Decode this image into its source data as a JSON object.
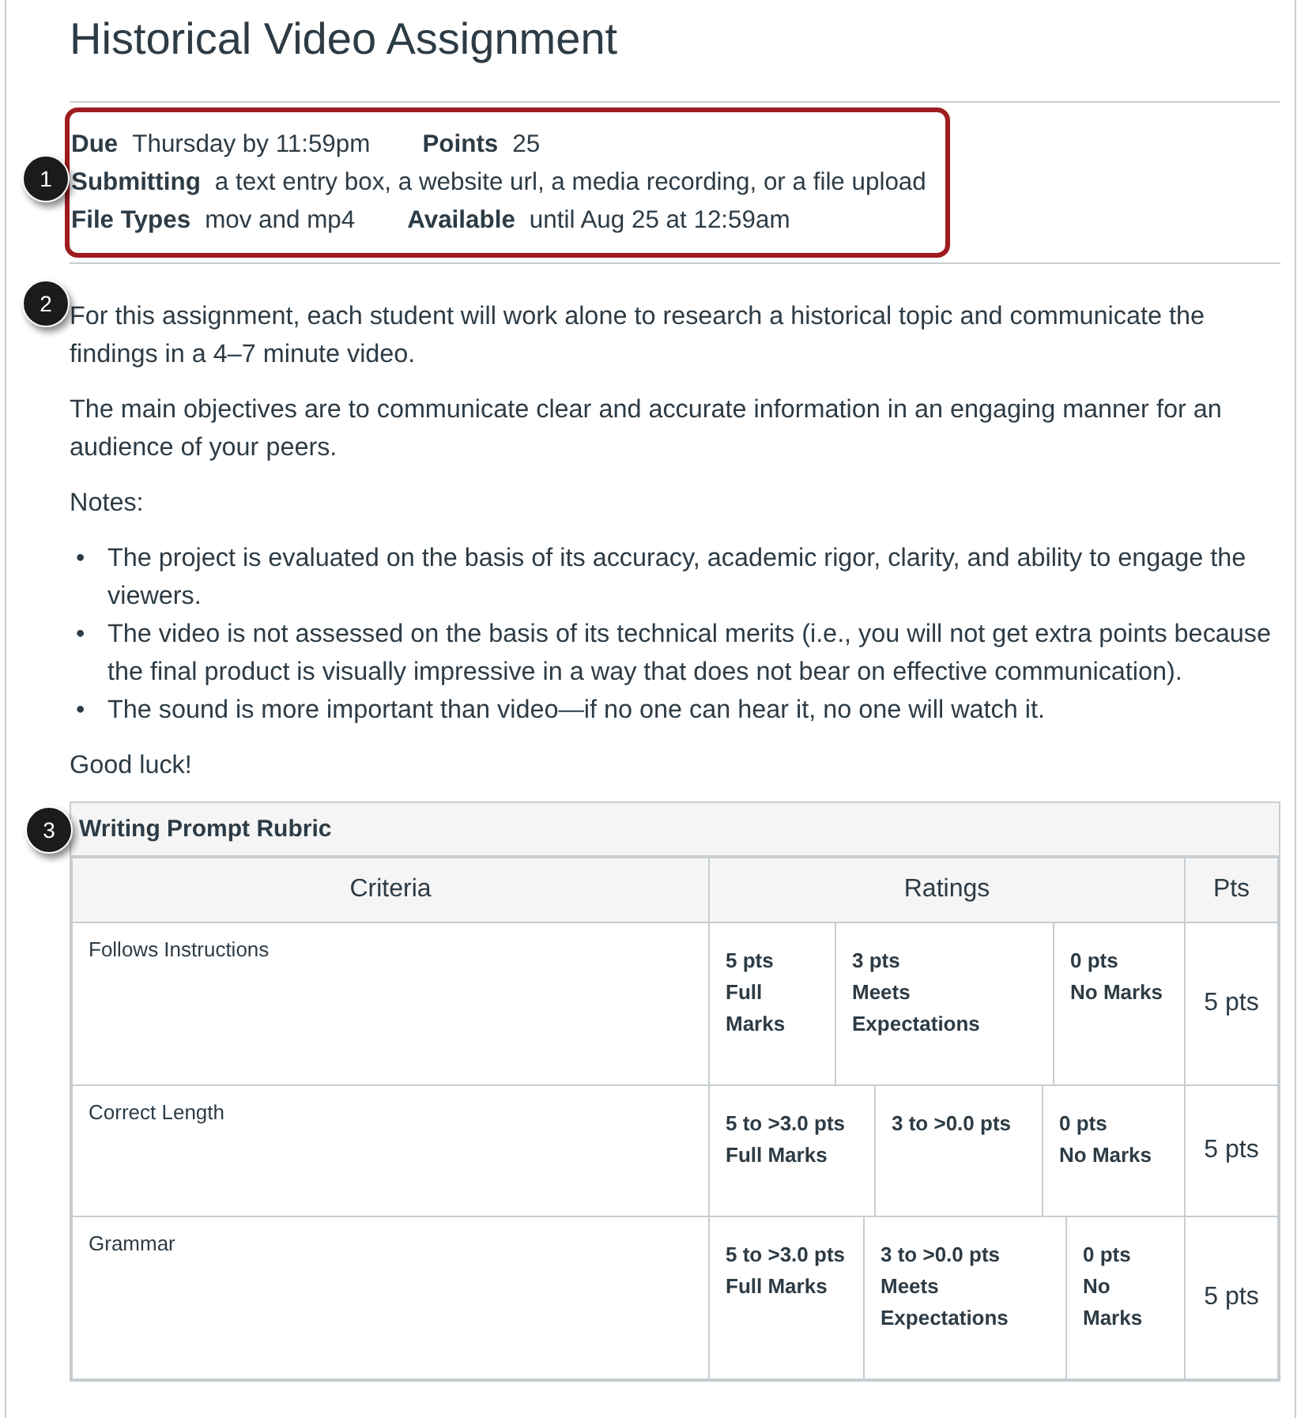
{
  "title": "Historical Video Assignment",
  "details": {
    "callout": "1",
    "rows": [
      [
        {
          "label": "Due",
          "value": "Thursday by 11:59pm"
        },
        {
          "label": "Points",
          "value": "25"
        }
      ],
      [
        {
          "label": "Submitting",
          "value": "a text entry box, a website url, a media recording, or a file upload"
        }
      ],
      [
        {
          "label": "File Types",
          "value": "mov and mp4"
        },
        {
          "label": "Available",
          "value": "until Aug 25 at 12:59am"
        }
      ]
    ]
  },
  "description": {
    "callout": "2",
    "blocks": [
      {
        "kind": "paragraph",
        "text": "For this assignment, each student will work alone to research a historical topic and communicate the findings in a 4–7 minute video."
      },
      {
        "kind": "paragraph",
        "text": "The main objectives are to communicate clear and accurate information in an engaging manner for an audience of your peers."
      },
      {
        "kind": "paragraph",
        "text": "Notes:"
      },
      {
        "kind": "list",
        "bullet": "•",
        "items": [
          "The project is evaluated on the basis of its accuracy, academic rigor, clarity, and ability to engage the viewers.",
          "The video is not assessed on the basis of its technical merits (i.e., you will not get extra points because the final product is visually impressive in a way that does not bear on effective communication).",
          "The sound is more important than video—if no one can hear it, no one will watch it."
        ]
      },
      {
        "kind": "paragraph",
        "text": "Good luck!"
      }
    ]
  },
  "rubric": {
    "callout": "3",
    "title": "Writing Prompt Rubric",
    "columns": [
      "Criteria",
      "Ratings",
      "Pts"
    ],
    "rows": [
      {
        "criterion": "Follows Instructions",
        "ratings": [
          {
            "points": "5 pts",
            "description": "Full Marks"
          },
          {
            "points": "3 pts",
            "description": "Meets Expectations"
          },
          {
            "points": "0 pts",
            "description": "No Marks"
          }
        ],
        "pts": "5 pts"
      },
      {
        "criterion": "Correct Length",
        "ratings": [
          {
            "points": "5 to >3.0 pts",
            "description": "Full Marks"
          },
          {
            "points": "3 to >0.0 pts"
          },
          {
            "points": "0 pts",
            "description": "No Marks"
          }
        ],
        "pts": "5 pts"
      },
      {
        "criterion": "Grammar",
        "ratings": [
          {
            "points": "5 to >3.0 pts",
            "description": "Full Marks"
          },
          {
            "points": "3 to >0.0 pts",
            "description": "Meets Expectations"
          },
          {
            "points": "0 pts",
            "description": "No Marks"
          }
        ],
        "pts": "5 pts"
      }
    ]
  }
}
